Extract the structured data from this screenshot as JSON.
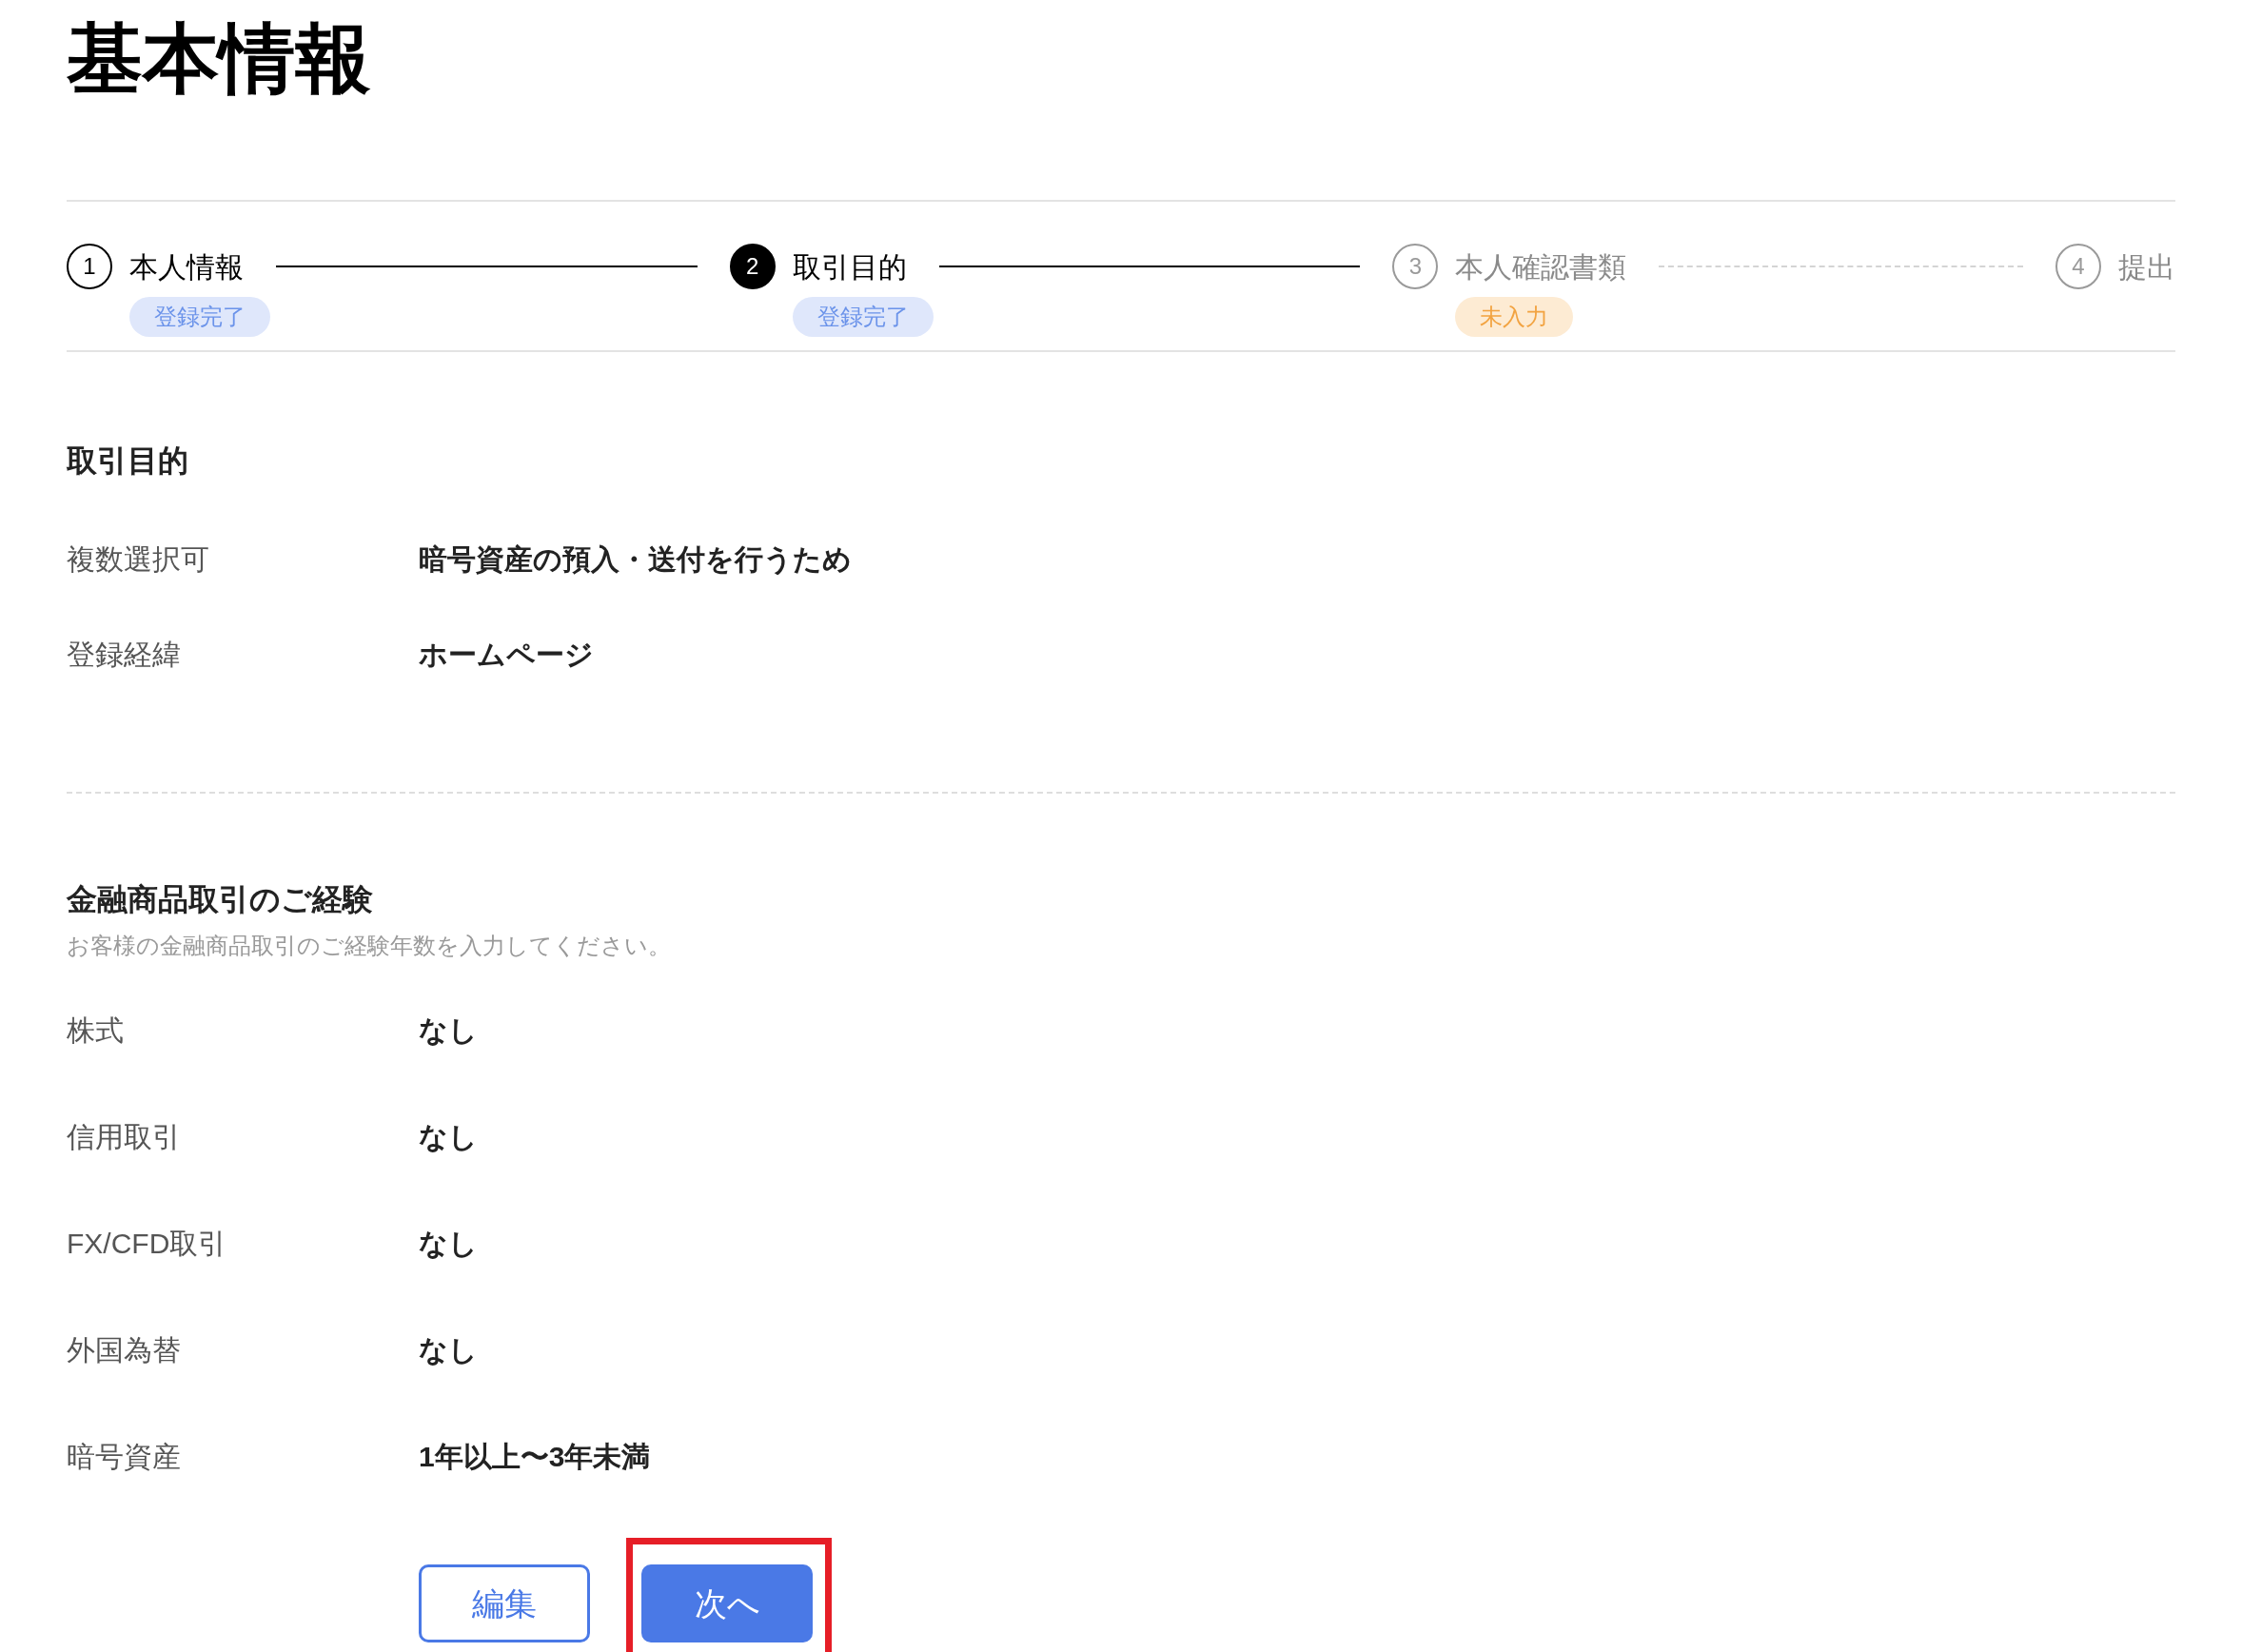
{
  "title": "基本情報",
  "steps": [
    {
      "number": "1",
      "label": "本人情報",
      "done": true,
      "selected": false,
      "badge": {
        "text": "登録完了",
        "kind": "done"
      }
    },
    {
      "number": "2",
      "label": "取引目的",
      "done": false,
      "selected": true,
      "badge": {
        "text": "登録完了",
        "kind": "done"
      }
    },
    {
      "number": "3",
      "label": "本人確認書類",
      "done": false,
      "selected": false,
      "badge": {
        "text": "未入力",
        "kind": "todo"
      }
    },
    {
      "number": "4",
      "label": "提出",
      "done": false,
      "selected": false
    }
  ],
  "sections": [
    {
      "heading": "取引目的",
      "rows": [
        {
          "label": "複数選択可",
          "value": "暗号資産の預入・送付を行うため"
        },
        {
          "label": "登録経緯",
          "value": "ホームページ"
        }
      ]
    },
    {
      "heading": "金融商品取引のご経験",
      "description": "お客様の金融商品取引のご経験年数を入力してください。",
      "rows": [
        {
          "label": "株式",
          "value": "なし"
        },
        {
          "label": "信用取引",
          "value": "なし"
        },
        {
          "label": "FX/CFD取引",
          "value": "なし"
        },
        {
          "label": "外国為替",
          "value": "なし"
        },
        {
          "label": "暗号資産",
          "value": "1年以上〜3年未満"
        }
      ]
    }
  ],
  "buttons": [
    {
      "label": "編集",
      "kind": "outline",
      "highlighted": false
    },
    {
      "label": "次へ",
      "kind": "primary",
      "highlighted": true
    }
  ]
}
